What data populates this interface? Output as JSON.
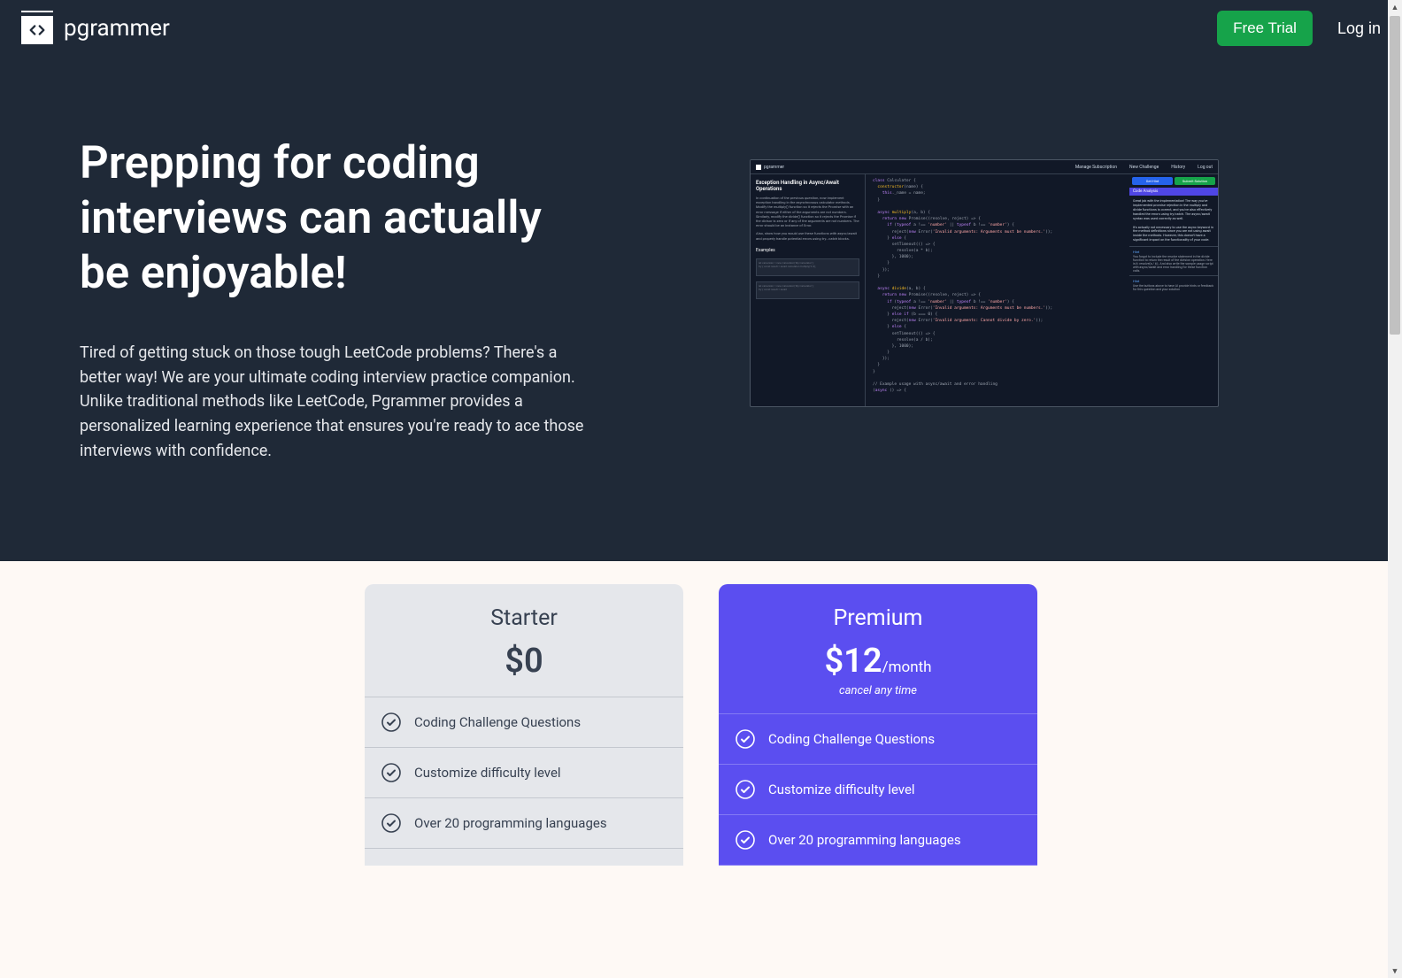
{
  "header": {
    "brand": "pgrammer",
    "free_trial": "Free Trial",
    "log_in": "Log in"
  },
  "hero": {
    "headline": "Prepping for coding interviews can actually be enjoyable!",
    "body": "Tired of getting stuck on those tough LeetCode problems? There's a better way! We are your ultimate coding interview practice companion. Unlike traditional methods like LeetCode, Pgrammer provides a personalized learning experience that ensures you're ready to ace those interviews with confidence."
  },
  "mock": {
    "brand": "pgrammer",
    "nav": {
      "manage": "Manage Subscription",
      "new": "New Challenge",
      "history": "History",
      "logout": "Log out"
    },
    "problem_title": "Exception Handling in Async/Await Operations",
    "examples_label": "Examples",
    "get_hint": "Get Hint",
    "submit": "Submit Solution",
    "code_analysis": "Code Analysis",
    "hint_label": "Hint"
  },
  "pricing": {
    "starter": {
      "name": "Starter",
      "price": "$0",
      "features": [
        "Coding Challenge Questions",
        "Customize difficulty level",
        "Over 20 programming languages"
      ]
    },
    "premium": {
      "name": "Premium",
      "price": "$12",
      "price_unit": "/month",
      "note": "cancel any time",
      "features": [
        "Coding Challenge Questions",
        "Customize difficulty level",
        "Over 20 programming languages"
      ]
    }
  }
}
